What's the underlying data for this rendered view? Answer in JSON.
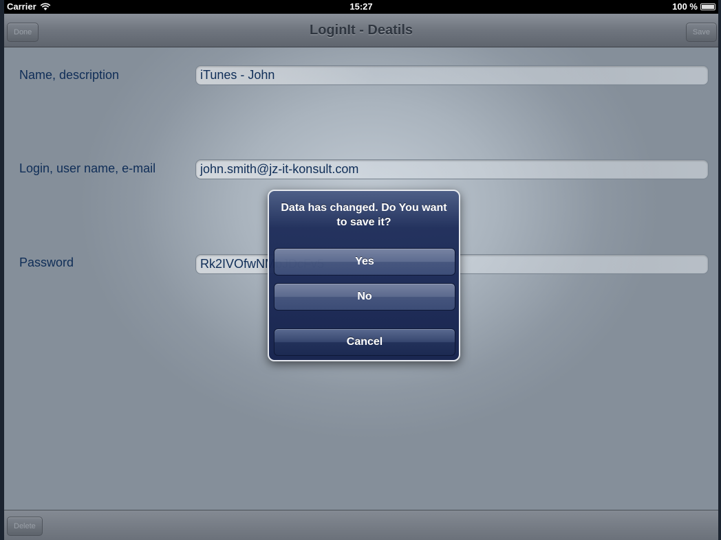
{
  "status": {
    "carrier": "Carrier",
    "time": "15:27",
    "battery": "100 %",
    "wifi_icon": "wifi-icon",
    "battery_icon": "battery-icon"
  },
  "nav": {
    "title": "LoginIt - Deatils",
    "left_button": "Done",
    "right_button": "Save"
  },
  "form": {
    "name_label": "Name, description",
    "name_value": "iTunes - John",
    "login_label": "Login, user name, e-mail",
    "login_value": "john.smith@jz-it-konsult.com",
    "password_label": "Password",
    "password_value": "Rk2IVOfwNMbJDcFv5"
  },
  "toolbar": {
    "delete_button": "Delete"
  },
  "alert": {
    "message": "Data has changed. Do You want to save it?",
    "yes": "Yes",
    "no": "No",
    "cancel": "Cancel"
  },
  "colors": {
    "label_text": "#0f2d57",
    "alert_bg": "#1c2a52",
    "navbar": "#6f757e"
  }
}
